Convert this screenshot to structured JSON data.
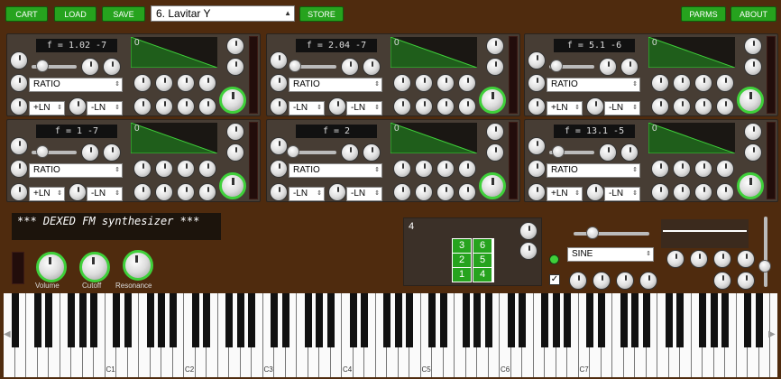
{
  "toolbar": {
    "cart_label": "CART",
    "load_label": "LOAD",
    "save_label": "SAVE",
    "store_label": "STORE",
    "parms_label": "PARMS",
    "about_label": "ABOUT",
    "preset_value": "6. Lavitar  Y"
  },
  "operators": [
    {
      "freq": "f = 1.02 -7",
      "env_level": "0",
      "mode": "RATIO",
      "left_curve": "+LN",
      "right_curve": "-LN"
    },
    {
      "freq": "f = 2.04 -7",
      "env_level": "0",
      "mode": "RATIO",
      "left_curve": "-LN",
      "right_curve": "-LN"
    },
    {
      "freq": "f = 5.1 -6",
      "env_level": "0",
      "mode": "RATIO",
      "left_curve": "+LN",
      "right_curve": "-LN"
    },
    {
      "freq": "f = 1 -7",
      "env_level": "0",
      "mode": "RATIO",
      "left_curve": "+LN",
      "right_curve": "-LN"
    },
    {
      "freq": "f = 2",
      "env_level": "0",
      "mode": "RATIO",
      "left_curve": "-LN",
      "right_curve": "-LN"
    },
    {
      "freq": "f = 13.1 -5",
      "env_level": "0",
      "mode": "RATIO",
      "left_curve": "+LN",
      "right_curve": "-LN"
    }
  ],
  "global": {
    "lcd_text": "*** DEXED FM synthesizer ***",
    "volume_label": "Volume",
    "cutoff_label": "Cutoff",
    "resonance_label": "Resonance",
    "algorithm_number": "4",
    "algorithm_ops": [
      "3",
      "6",
      "2",
      "5",
      "1",
      "4"
    ],
    "lfo_wave": "SINE"
  },
  "keyboard": {
    "octave_labels": [
      "C1",
      "C2",
      "C3",
      "C4",
      "C5",
      "C6",
      "C7"
    ],
    "scroll_left": "◀",
    "scroll_right": "▶"
  },
  "colors": {
    "accent": "#26a31e",
    "background": "#4f2b0e",
    "panel": "#473d34"
  }
}
